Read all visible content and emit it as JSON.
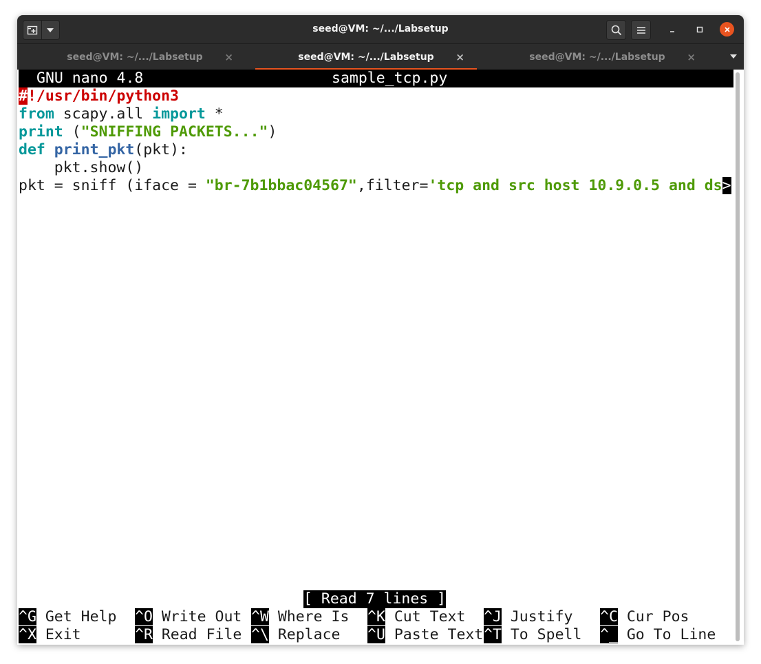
{
  "window": {
    "title": "seed@VM: ~/.../Labsetup",
    "tabs": [
      {
        "label": "seed@VM: ~/.../Labsetup",
        "active": false
      },
      {
        "label": "seed@VM: ~/.../Labsetup",
        "active": true
      },
      {
        "label": "seed@VM: ~/.../Labsetup",
        "active": false
      }
    ],
    "tab_close_glyph": "×",
    "accent_color": "#e95420"
  },
  "nano": {
    "version": "GNU nano 4.8",
    "filename": "sample_tcp.py",
    "status_message": "[ Read 7 lines ]",
    "code": {
      "l1_hash": "#",
      "l1_rest": "!/usr/bin/python3",
      "l2_kw1": "from",
      "l2_mid": " scapy.all ",
      "l2_kw2": "import",
      "l2_end": " *",
      "l3_kw": "print",
      "l3_open": " (",
      "l3_str": "\"SNIFFING PACKETS...\"",
      "l3_close": ")",
      "l4_kw": "def",
      "l4_sp": " ",
      "l4_fn": "print_pkt",
      "l4_rest": "(pkt):",
      "l5": "    pkt.show()",
      "l6_a": "pkt = sniff (iface = ",
      "l6_str1": "\"br-7b1bbac04567\"",
      "l6_b": ",filter=",
      "l6_str2": "'tcp and src host 10.9.0.5 and ds",
      "l6_overflow": ">"
    },
    "shortcuts": [
      {
        "key": "^G",
        "label": "Get Help"
      },
      {
        "key": "^O",
        "label": "Write Out"
      },
      {
        "key": "^W",
        "label": "Where Is"
      },
      {
        "key": "^K",
        "label": "Cut Text"
      },
      {
        "key": "^J",
        "label": "Justify"
      },
      {
        "key": "^C",
        "label": "Cur Pos"
      },
      {
        "key": "^X",
        "label": "Exit"
      },
      {
        "key": "^R",
        "label": "Read File"
      },
      {
        "key": "^\\",
        "label": "Replace"
      },
      {
        "key": "^U",
        "label": "Paste Text"
      },
      {
        "key": "^T",
        "label": "To Spell"
      },
      {
        "key": "^_",
        "label": "Go To Line"
      }
    ]
  },
  "icons": [
    "new-tab-icon",
    "dropdown-arrow-icon",
    "search-icon",
    "hamburger-menu-icon",
    "minimize-icon",
    "maximize-icon",
    "close-icon"
  ]
}
